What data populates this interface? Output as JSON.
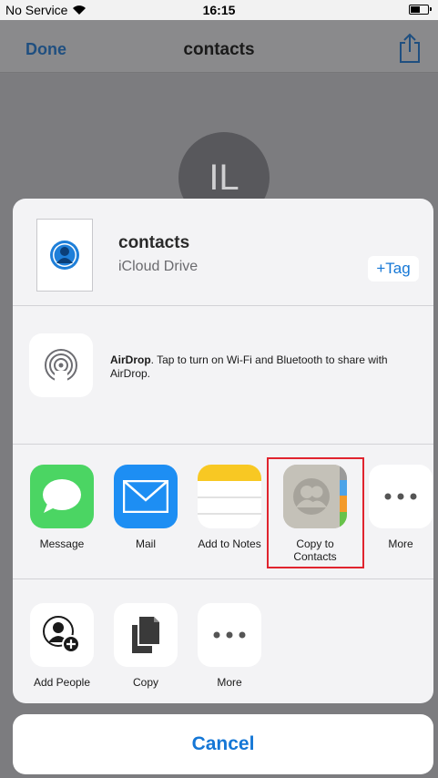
{
  "status_bar": {
    "carrier": "No Service",
    "time": "16:15",
    "battery_level": 0.55
  },
  "nav": {
    "done_label": "Done",
    "title": "contacts"
  },
  "background": {
    "avatar_initials": "IL"
  },
  "sheet": {
    "document": {
      "title": "contacts",
      "location": "iCloud Drive",
      "tag_label": "+Tag"
    },
    "airdrop": {
      "title": "AirDrop",
      "message": ". Tap to turn on Wi-Fi and Bluetooth to share with AirDrop."
    },
    "apps": [
      {
        "label": "Message",
        "icon": "message-icon"
      },
      {
        "label": "Mail",
        "icon": "mail-icon"
      },
      {
        "label": "Add to Notes",
        "icon": "notes-icon"
      },
      {
        "label": "Copy to Contacts",
        "icon": "contacts-icon"
      },
      {
        "label": "More",
        "icon": "more-icon"
      }
    ],
    "actions": [
      {
        "label": "Add People",
        "icon": "add-people-icon"
      },
      {
        "label": "Copy",
        "icon": "copy-icon"
      },
      {
        "label": "More",
        "icon": "more-icon"
      }
    ],
    "cancel_label": "Cancel"
  },
  "colors": {
    "accent": "#1577d6",
    "highlight": "#e0242e"
  }
}
